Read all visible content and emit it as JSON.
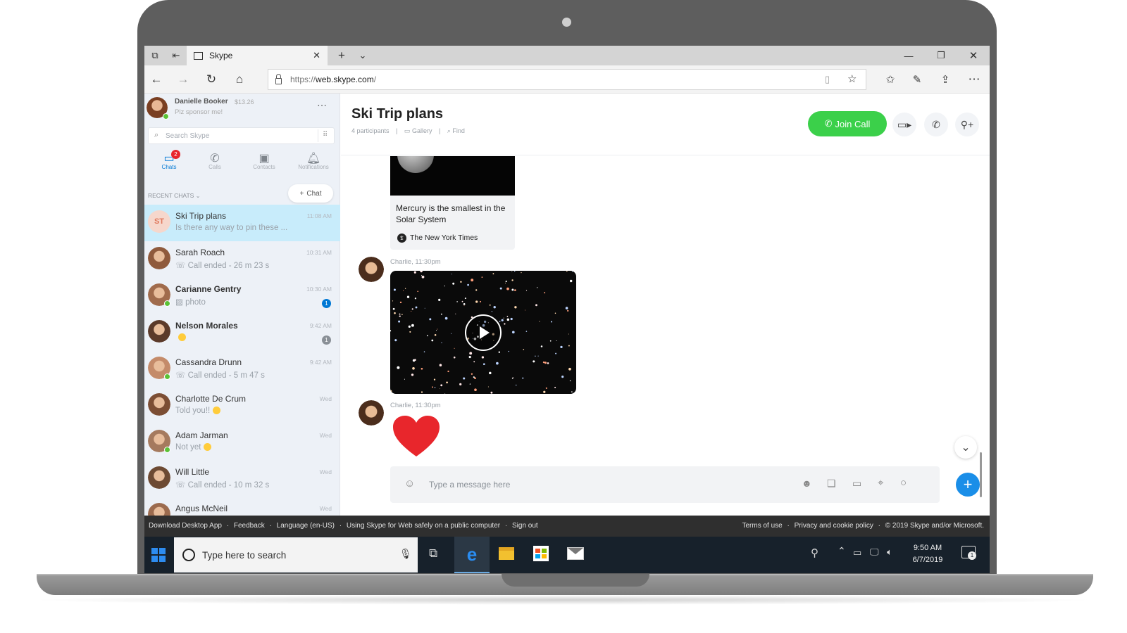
{
  "browser": {
    "tab_title": "Skype",
    "url_prefix": "https://",
    "url_domain": "web.skype.com",
    "url_suffix": "/"
  },
  "profile": {
    "name": "Danielle Booker",
    "balance": "$13.26",
    "mood": "Plz sponsor me!"
  },
  "search": {
    "placeholder": "Search Skype"
  },
  "nav_tabs": [
    {
      "label": "Chats",
      "badge": "2",
      "icon": "chat-icon"
    },
    {
      "label": "Calls",
      "icon": "phone-icon"
    },
    {
      "label": "Contacts",
      "icon": "contacts-icon"
    },
    {
      "label": "Notifications",
      "icon": "bell-icon"
    }
  ],
  "recent_chats_label": "RECENT CHATS",
  "new_chat_label": "Chat",
  "chats": [
    {
      "name": "Ski Trip plans",
      "initials": "ST",
      "message": "Is there any way to pin these ...",
      "time": "11:08 AM",
      "selected": true
    },
    {
      "name": "Sarah Roach",
      "message": "Call ended - 26 m 23 s",
      "time": "10:31 AM",
      "call": true
    },
    {
      "name": "Carianne Gentry",
      "message": "photo",
      "time": "10:30 AM",
      "badge": "1",
      "bold": true,
      "photo": true
    },
    {
      "name": "Nelson Morales",
      "message": "",
      "time": "9:42 AM",
      "badge": "1",
      "bold": true,
      "emoji": true
    },
    {
      "name": "Cassandra Drunn",
      "message": "Call ended - 5 m 47 s",
      "time": "9:42 AM",
      "call": true
    },
    {
      "name": "Charlotte De Crum",
      "message": "Told you!!",
      "time": "Wed",
      "emoji": true
    },
    {
      "name": "Adam Jarman",
      "message": "Not yet",
      "time": "Wed",
      "emoji": true
    },
    {
      "name": "Will Little",
      "message": "Call ended - 10 m 32 s",
      "time": "Wed",
      "call": true
    },
    {
      "name": "Angus McNeil",
      "message": "",
      "time": "Wed"
    }
  ],
  "conversation": {
    "title": "Ski Trip plans",
    "participants": "4 participants",
    "gallery": "Gallery",
    "find": "Find",
    "join_call": "Join Call",
    "link_card": {
      "headline": "Mercury is the smallest in the Solar System",
      "source": "The New York Times"
    },
    "messages": [
      {
        "sender": "Charlie, 11:30pm",
        "type": "video"
      },
      {
        "sender": "Charlie, 11:30pm",
        "type": "heart"
      }
    ],
    "compose_placeholder": "Type a message here"
  },
  "footer_links": [
    "Download Desktop App",
    "Feedback",
    "Language (en-US)",
    "Using Skype for Web safely on a public computer",
    "Sign out"
  ],
  "footer_right": [
    "Terms of use",
    "Privacy and cookie policy",
    "© 2019 Skype and/or Microsoft."
  ],
  "taskbar": {
    "search_placeholder": "Type here to search",
    "time": "9:50 AM",
    "date": "6/7/2019",
    "notification_count": "1"
  },
  "colors": {
    "accent": "#0078d4",
    "join_green": "#3bd04a",
    "heart": "#e8262c",
    "selected_row": "#c8ecfb"
  }
}
